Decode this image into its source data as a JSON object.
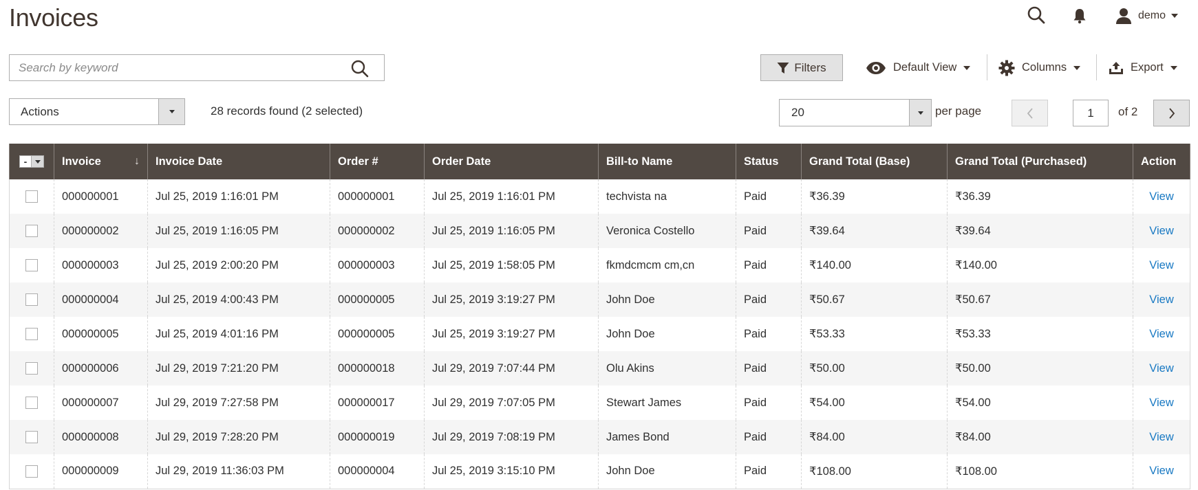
{
  "page": {
    "title": "Invoices"
  },
  "header": {
    "user_name": "demo",
    "icons": [
      "search-icon",
      "bell-icon",
      "user-icon"
    ]
  },
  "search": {
    "placeholder": "Search by keyword",
    "value": ""
  },
  "toolbar": {
    "filters_label": "Filters",
    "view_label": "Default View",
    "columns_label": "Columns",
    "export_label": "Export"
  },
  "mass_actions": {
    "label": "Actions"
  },
  "records": {
    "summary": "28 records found (2 selected)"
  },
  "pagination": {
    "per_page_value": "20",
    "per_page_label": "per page",
    "current_page": "1",
    "total_pages_label": "of 2"
  },
  "table": {
    "sort_indicator": "↓",
    "columns": [
      "Invoice",
      "Invoice Date",
      "Order #",
      "Order Date",
      "Bill-to Name",
      "Status",
      "Grand Total (Base)",
      "Grand Total (Purchased)",
      "Action"
    ],
    "mass_select_label": "-",
    "rows": [
      {
        "invoice": "000000001",
        "invoice_date": "Jul 25, 2019 1:16:01 PM",
        "order": "000000001",
        "order_date": "Jul 25, 2019 1:16:01 PM",
        "bill_to": "techvista na",
        "status": "Paid",
        "total_base": "₹36.39",
        "total_purchased": "₹36.39",
        "action": "View",
        "checked": false
      },
      {
        "invoice": "000000002",
        "invoice_date": "Jul 25, 2019 1:16:05 PM",
        "order": "000000002",
        "order_date": "Jul 25, 2019 1:16:05 PM",
        "bill_to": "Veronica Costello",
        "status": "Paid",
        "total_base": "₹39.64",
        "total_purchased": "₹39.64",
        "action": "View",
        "checked": false
      },
      {
        "invoice": "000000003",
        "invoice_date": "Jul 25, 2019 2:00:20 PM",
        "order": "000000003",
        "order_date": "Jul 25, 2019 1:58:05 PM",
        "bill_to": "fkmdcmcm cm,cn",
        "status": "Paid",
        "total_base": "₹140.00",
        "total_purchased": "₹140.00",
        "action": "View",
        "checked": false
      },
      {
        "invoice": "000000004",
        "invoice_date": "Jul 25, 2019 4:00:43 PM",
        "order": "000000005",
        "order_date": "Jul 25, 2019 3:19:27 PM",
        "bill_to": "John Doe",
        "status": "Paid",
        "total_base": "₹50.67",
        "total_purchased": "₹50.67",
        "action": "View",
        "checked": false
      },
      {
        "invoice": "000000005",
        "invoice_date": "Jul 25, 2019 4:01:16 PM",
        "order": "000000005",
        "order_date": "Jul 25, 2019 3:19:27 PM",
        "bill_to": "John Doe",
        "status": "Paid",
        "total_base": "₹53.33",
        "total_purchased": "₹53.33",
        "action": "View",
        "checked": false
      },
      {
        "invoice": "000000006",
        "invoice_date": "Jul 29, 2019 7:21:20 PM",
        "order": "000000018",
        "order_date": "Jul 29, 2019 7:07:44 PM",
        "bill_to": "Olu Akins",
        "status": "Paid",
        "total_base": "₹50.00",
        "total_purchased": "₹50.00",
        "action": "View",
        "checked": false
      },
      {
        "invoice": "000000007",
        "invoice_date": "Jul 29, 2019 7:27:58 PM",
        "order": "000000017",
        "order_date": "Jul 29, 2019 7:07:05 PM",
        "bill_to": "Stewart James",
        "status": "Paid",
        "total_base": "₹54.00",
        "total_purchased": "₹54.00",
        "action": "View",
        "checked": false
      },
      {
        "invoice": "000000008",
        "invoice_date": "Jul 29, 2019 7:28:20 PM",
        "order": "000000019",
        "order_date": "Jul 29, 2019 7:08:19 PM",
        "bill_to": "James Bond",
        "status": "Paid",
        "total_base": "₹84.00",
        "total_purchased": "₹84.00",
        "action": "View",
        "checked": false
      },
      {
        "invoice": "000000009",
        "invoice_date": "Jul 29, 2019 11:36:03 PM",
        "order": "000000004",
        "order_date": "Jul 25, 2019 3:15:10 PM",
        "bill_to": "John Doe",
        "status": "Paid",
        "total_base": "₹108.00",
        "total_purchased": "₹108.00",
        "action": "View",
        "checked": false
      }
    ]
  },
  "colors": {
    "header_bg": "#514943",
    "link": "#1979c3",
    "row_alt": "#f5f5f5",
    "button_bg": "#e3e3e3"
  }
}
